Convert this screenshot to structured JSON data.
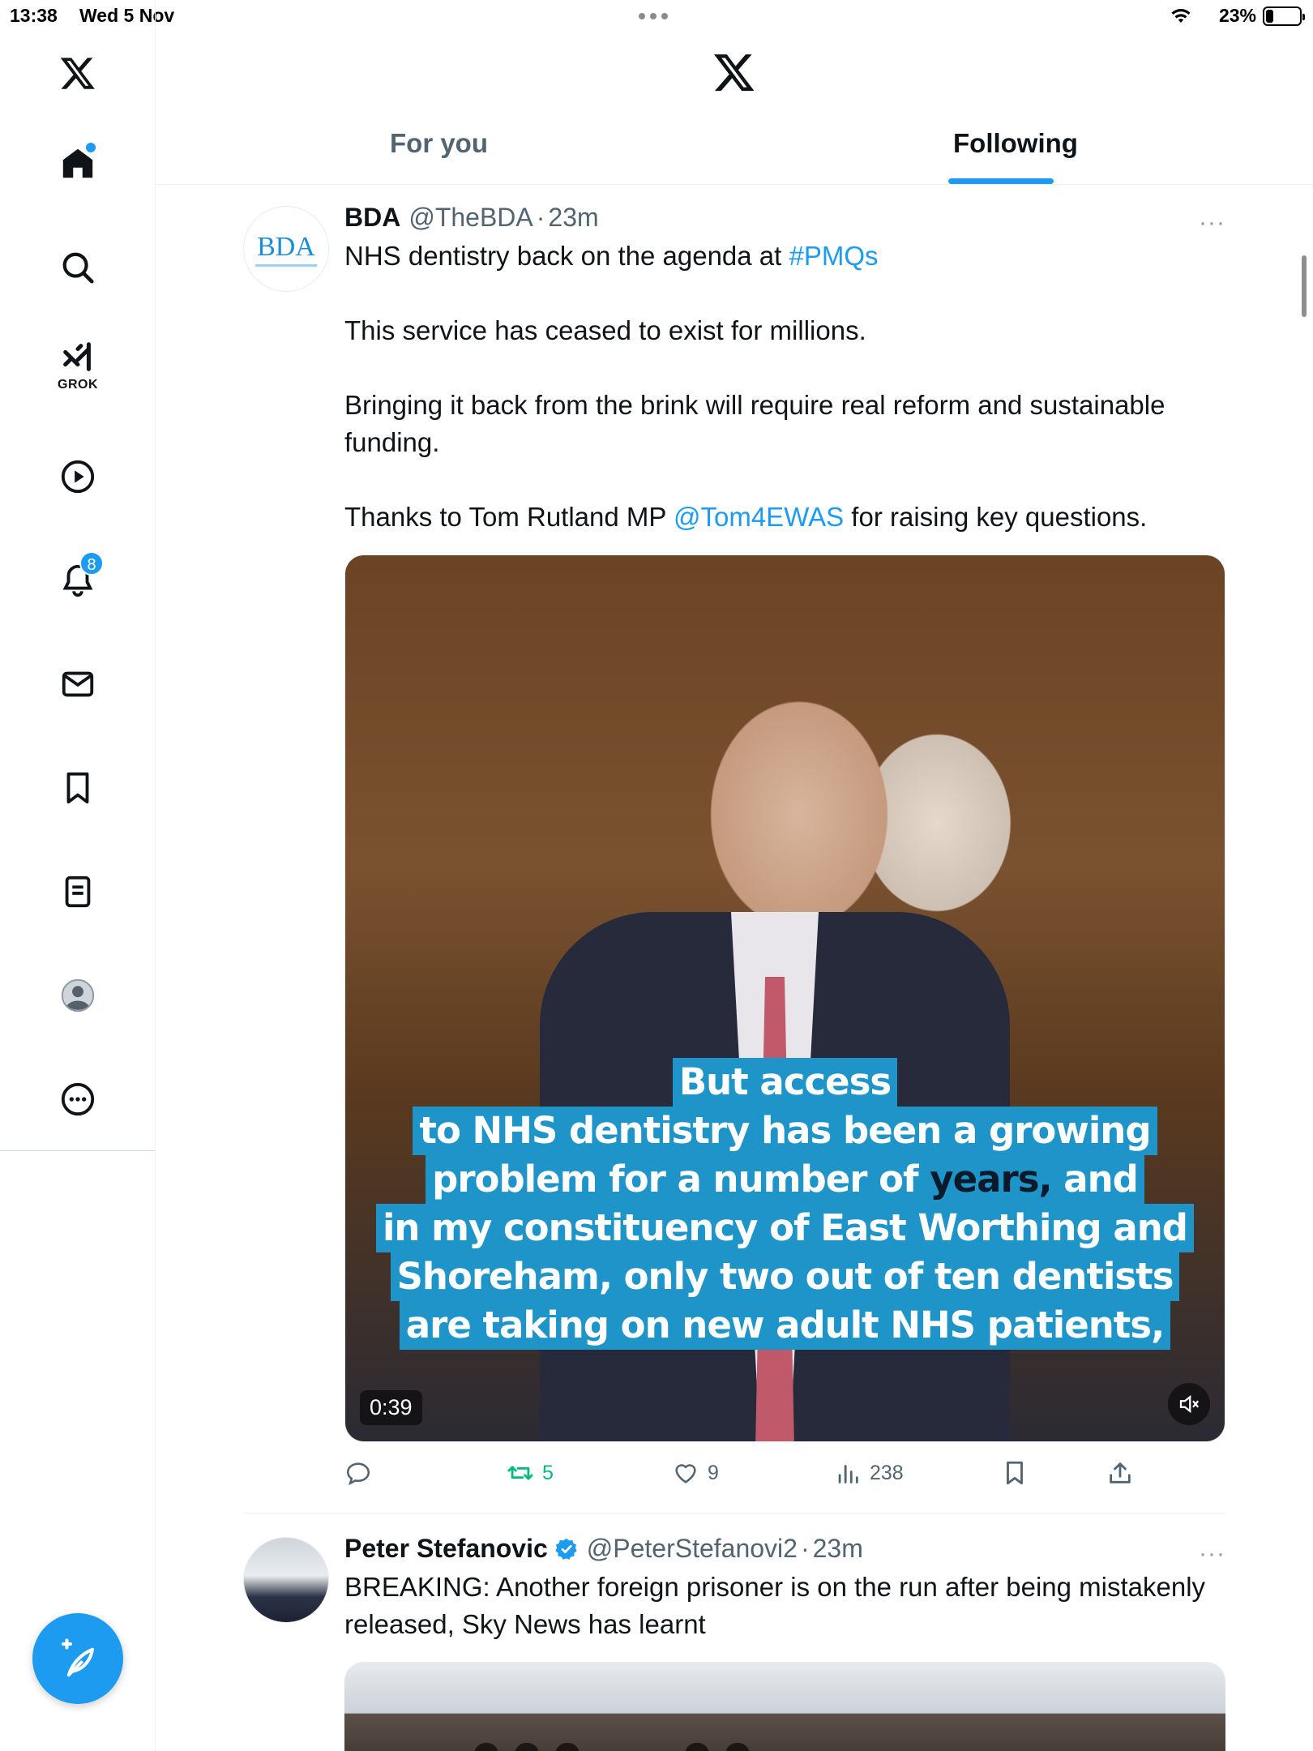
{
  "status_bar": {
    "time": "13:38",
    "date": "Wed 5 Nov",
    "battery": "23%",
    "battery_level": 0.23
  },
  "sidebar": {
    "items": [
      {
        "name": "x-logo",
        "icon": "x-logo-icon"
      },
      {
        "name": "home",
        "icon": "home-icon",
        "has_dot": true
      },
      {
        "name": "explore",
        "icon": "search-icon"
      },
      {
        "name": "grok",
        "icon": "grok-icon",
        "label": "GROK"
      },
      {
        "name": "video",
        "icon": "play-icon"
      },
      {
        "name": "notifications",
        "icon": "bell-icon",
        "badge": "8"
      },
      {
        "name": "messages",
        "icon": "mail-icon"
      },
      {
        "name": "bookmarks",
        "icon": "bookmark-icon"
      },
      {
        "name": "lists",
        "icon": "list-icon"
      },
      {
        "name": "profile",
        "icon": "avatar-icon"
      },
      {
        "name": "more",
        "icon": "more-circle-icon"
      }
    ],
    "compose_icon": "compose-icon"
  },
  "header": {
    "tabs": [
      {
        "label": "For you",
        "active": false
      },
      {
        "label": "Following",
        "active": true
      }
    ],
    "accent": "#1d9bf0"
  },
  "tweets": [
    {
      "name": "BDA",
      "handle": "@TheBDA",
      "sep": "·",
      "time": "23m",
      "avatar_text": "BDA",
      "text_1_prefix": "NHS dentistry back on the agenda at ",
      "text_1_link": "#PMQs",
      "text_2": "This service has ceased to exist for millions.",
      "text_3": "Bringing it back from the brink will require real reform and sustainable funding.",
      "text_4_prefix": "Thanks to Tom Rutland MP ",
      "text_4_link": "@Tom4EWAS",
      "text_4_suffix": " for raising key questions.",
      "video": {
        "subtitle_lines": [
          "But access",
          "to NHS dentistry has been a growing",
          "problem for a number of",
          "in my constituency of East Worthing and",
          "Shoreham, only two out of ten dentists",
          "are taking on new adult NHS patients,"
        ],
        "subtitle_highlight": "years,",
        "subtitle_after_highlight": " and",
        "duration": "0:39"
      },
      "actions": {
        "replies": "",
        "retweets": "5",
        "likes": "9",
        "views": "238"
      }
    },
    {
      "name": "Peter Stefanovic",
      "verified": true,
      "handle": "@PeterStefanovi2",
      "sep": "·",
      "time": "23m",
      "text": "BREAKING: Another foreign prisoner is on the run after being mistakenly released, Sky News has learnt"
    }
  ],
  "more_label": "···"
}
